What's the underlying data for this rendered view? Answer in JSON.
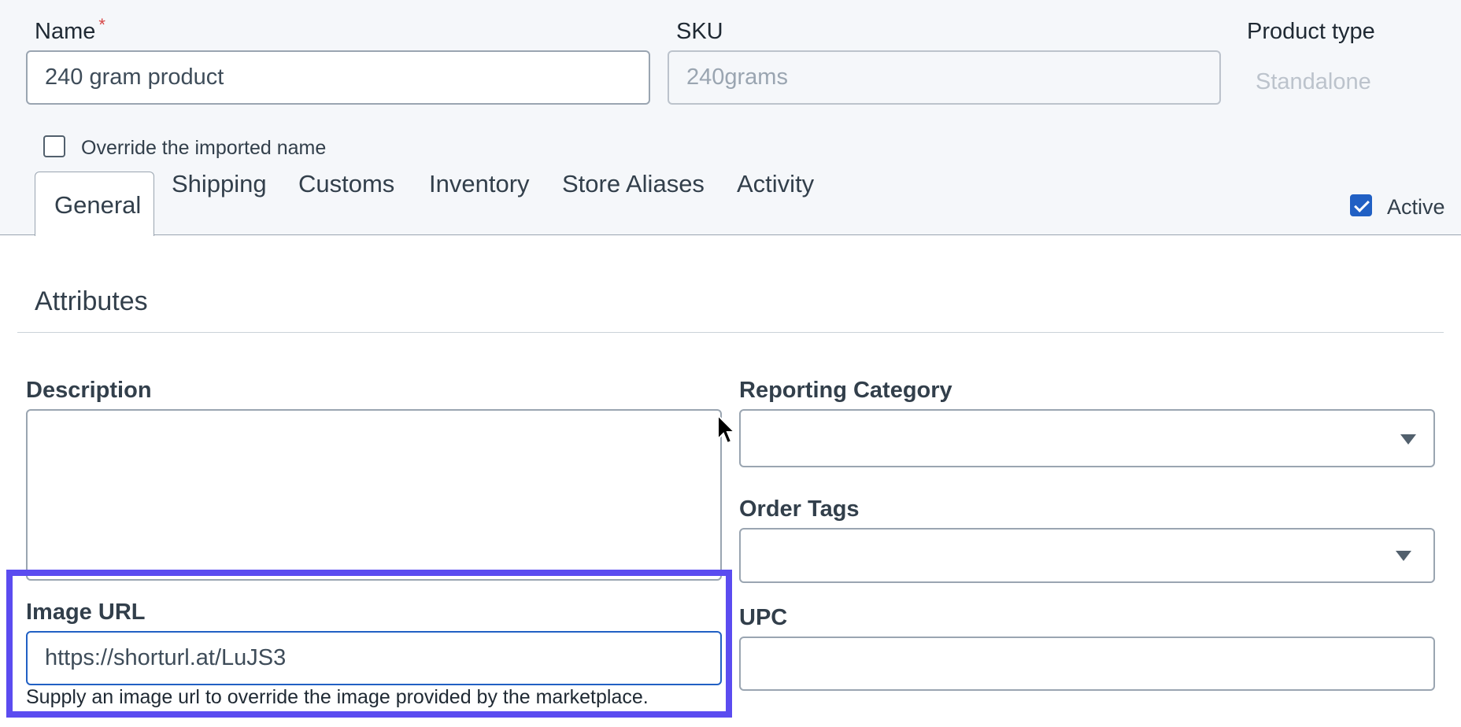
{
  "header": {
    "name_label": "Name",
    "required_mark": "*",
    "name_value": "240 gram product",
    "sku_label": "SKU",
    "sku_value": "240grams",
    "product_type_label": "Product type",
    "product_type_value": "Standalone",
    "override_label": "Override the imported name",
    "override_checked": false
  },
  "tabs": [
    {
      "label": "General",
      "active": true
    },
    {
      "label": "Shipping",
      "active": false
    },
    {
      "label": "Customs",
      "active": false
    },
    {
      "label": "Inventory",
      "active": false
    },
    {
      "label": "Store Aliases",
      "active": false
    },
    {
      "label": "Activity",
      "active": false
    }
  ],
  "active_toggle": {
    "label": "Active",
    "checked": true
  },
  "attributes": {
    "title": "Attributes",
    "description_label": "Description",
    "description_value": "",
    "image_url_label": "Image URL",
    "image_url_value": "https://shorturl.at/LuJS3",
    "image_url_hint": "Supply an image url to override the image provided by the marketplace.",
    "reporting_category_label": "Reporting Category",
    "reporting_category_value": "",
    "order_tags_label": "Order Tags",
    "order_tags_value": "",
    "upc_label": "UPC",
    "upc_value": ""
  },
  "colors": {
    "accent": "#2160c4",
    "highlight": "#5b4cf0",
    "required": "#d64545"
  }
}
